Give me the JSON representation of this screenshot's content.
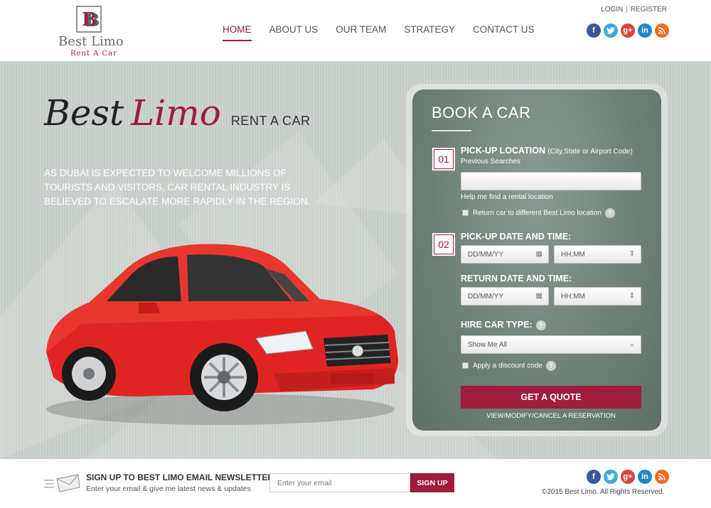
{
  "logo": {
    "mark": "B",
    "name": "Best Limo",
    "subtitle": "Rent A Car"
  },
  "nav": [
    {
      "label": "HOME",
      "active": true
    },
    {
      "label": "ABOUT US"
    },
    {
      "label": "OUR TEAM"
    },
    {
      "label": "STRATEGY"
    },
    {
      "label": "CONTACT US"
    }
  ],
  "auth": {
    "login": "LOGIN",
    "separator": "|",
    "register": "REGISTER"
  },
  "social": {
    "facebook": "f",
    "twitter": "t",
    "googleplus": "g+",
    "linkedin": "in",
    "rss": "rss"
  },
  "hero": {
    "title_best": "Best",
    "title_limo": "Limo",
    "title_rest": "RENT A CAR",
    "text": "AS DUBAI IS EXPECTED TO WELCOME MILLIONS OF TOURISTS AND VISITORS, CAR RENTAL INDUSTRY IS BELIEVED TO ESCALATE MORE RAPIDLY IN THE REGION."
  },
  "booking": {
    "title": "BOOK A CAR",
    "step1": "01",
    "step2": "02",
    "pickup_location_label": "PICK-UP LOCATION",
    "pickup_location_hint": "(City,State or Airport Code)",
    "previous_searches": "Previous Searches",
    "location_value": "",
    "help_find": "Help me find a rental location",
    "return_different": "Return car to different Best Limo location",
    "pickup_datetime_label": "PICK-UP DATE AND TIME:",
    "return_datetime_label": "RETURN DATE AND TIME:",
    "date_placeholder": "DD/MM/YY",
    "time_placeholder": "HH:MM",
    "hire_type_label": "HIRE CAR TYPE:",
    "hire_type_value": "Show Me All",
    "discount": "Apply a discount code",
    "quote_button": "GET A QUOTE",
    "view_link": "VIEW/MODIFY/CANCEL A RESERVATION",
    "help_glyph": "?"
  },
  "footer": {
    "newsletter_title": "SIGN UP TO BEST LIMO EMAIL NEWSLETTER",
    "newsletter_sub": "Enter your email & give me latest news & updates",
    "email_placeholder": "Enter your email",
    "signup_button": "SIGN UP",
    "copyright": "©2015 Best Limo. All Rights Reserved."
  },
  "colors": {
    "accent": "#9e1c3c",
    "panel": "#6e7f76",
    "hero_bg": "#c9d0cb",
    "car": "#e02424"
  }
}
